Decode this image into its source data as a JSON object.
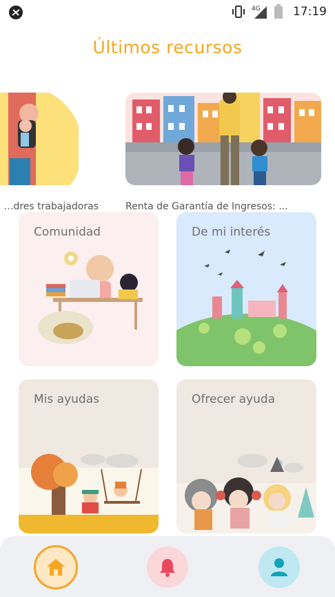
{
  "status": {
    "time": "17:19",
    "network": "4G",
    "icons": [
      "no-sync-icon",
      "vibrate-icon",
      "signal-icon",
      "battery-icon"
    ]
  },
  "header": {
    "title": "Últimos recursos"
  },
  "resources": [
    {
      "label": "Ayudas para madres trabajadoras"
    },
    {
      "label": "Renta de Garantía de Ingresos: ..."
    }
  ],
  "tiles": [
    {
      "label": "Comunidad",
      "bg": "#fbeff0"
    },
    {
      "label": "De mi interés",
      "bg": "#d8eafb"
    },
    {
      "label": "Mis ayudas",
      "bg": "#efe9e2"
    },
    {
      "label": "Ofrecer ayuda",
      "bg": "#efe9e2"
    }
  ],
  "nav": {
    "items": [
      {
        "name": "home",
        "icon": "home-icon",
        "active": true
      },
      {
        "name": "notifications",
        "icon": "bell-icon",
        "active": false
      },
      {
        "name": "profile",
        "icon": "user-icon",
        "active": false
      }
    ]
  },
  "colors": {
    "accent": "#f5a623",
    "home_bg": "#fde7c4",
    "bell_bg": "#fbd7dc",
    "bell": "#e9495f",
    "user_bg": "#bfe8f2",
    "user": "#12a3b8"
  }
}
